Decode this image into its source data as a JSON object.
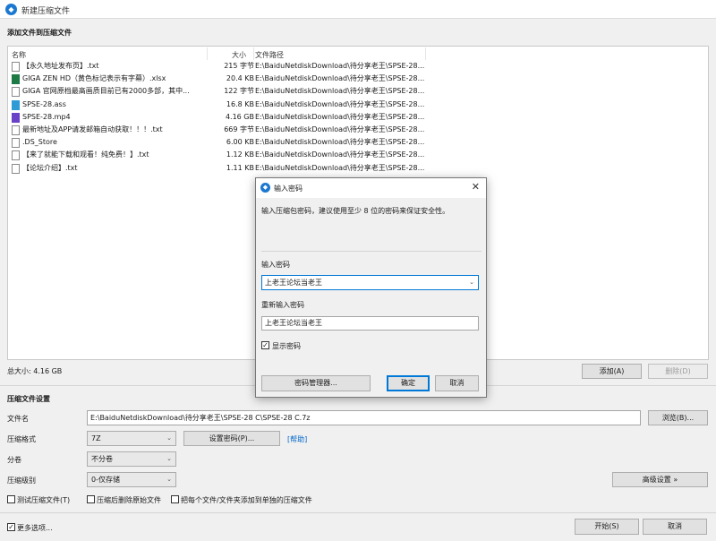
{
  "window": {
    "title": "新建压缩文件",
    "app_icon": "app-logo-icon"
  },
  "file_section": {
    "title": "添加文件到压缩文件",
    "columns": {
      "name": "名称",
      "size": "大小",
      "path": "文件路径"
    },
    "files": [
      {
        "name": "【永久地址发布页】.txt",
        "size": "215 字节",
        "path": "E:\\BaiduNetdiskDownload\\待分享老王\\SPSE-28...",
        "icon": "txt"
      },
      {
        "name": "GIGA ZEN HD（黄色标记表示有字幕）.xlsx",
        "size": "20.4 KB",
        "path": "E:\\BaiduNetdiskDownload\\待分享老王\\SPSE-28...",
        "icon": "xlsx"
      },
      {
        "name": "GIGA 官网原档最高画质目前已有2000多部，其中...",
        "size": "122 字节",
        "path": "E:\\BaiduNetdiskDownload\\待分享老王\\SPSE-28...",
        "icon": "txt"
      },
      {
        "name": "SPSE-28.ass",
        "size": "16.8 KB",
        "path": "E:\\BaiduNetdiskDownload\\待分享老王\\SPSE-28...",
        "icon": "ass"
      },
      {
        "name": "SPSE-28.mp4",
        "size": "4.16 GB",
        "path": "E:\\BaiduNetdiskDownload\\待分享老王\\SPSE-28...",
        "icon": "mp4"
      },
      {
        "name": "最新地址及APP请发邮箱自动获取！！！.txt",
        "size": "669 字节",
        "path": "E:\\BaiduNetdiskDownload\\待分享老王\\SPSE-28...",
        "icon": "txt"
      },
      {
        "name": ".DS_Store",
        "size": "6.00 KB",
        "path": "E:\\BaiduNetdiskDownload\\待分享老王\\SPSE-28...",
        "icon": "file"
      },
      {
        "name": "【来了就能下载和观看！纯免费！】.txt",
        "size": "1.12 KB",
        "path": "E:\\BaiduNetdiskDownload\\待分享老王\\SPSE-28...",
        "icon": "txt"
      },
      {
        "name": "【论坛介绍】.txt",
        "size": "1.11 KB",
        "path": "E:\\BaiduNetdiskDownload\\待分享老王\\SPSE-28...",
        "icon": "txt"
      }
    ],
    "total": "总大小: 4.16 GB",
    "add_label": "添加(A)",
    "delete_label": "删除(D)"
  },
  "settings": {
    "title": "压缩文件设置",
    "filename_label": "文件名",
    "filename_value": "E:\\BaiduNetdiskDownload\\待分享老王\\SPSE-28 C\\SPSE-28 C.7z",
    "browse_label": "浏览(B)...",
    "format_label": "压缩格式",
    "format_value": "7Z",
    "set_password_label": "设置密码(P)...",
    "help_label": "[帮助]",
    "split_label": "分卷",
    "split_value": "不分卷",
    "level_label": "压缩级别",
    "level_value": "0-仅存储",
    "advanced_label": "高级设置 »",
    "test_label": "测试压缩文件(T)",
    "delete_after_label": "压缩后删除原始文件",
    "separate_label": "把每个文件/文件夹添加到单独的压缩文件"
  },
  "footer": {
    "more_options_label": "更多选项...",
    "start_label": "开始(S)",
    "cancel_label": "取消"
  },
  "dialog": {
    "title": "输入密码",
    "hint": "输入压缩包密码，建议使用至少 8 位的密码来保证安全性。",
    "password_label": "输入密码",
    "password_value": "上老王论坛当老王",
    "confirm_label": "重新输入密码",
    "confirm_value": "上老王论坛当老王",
    "show_password_label": "显示密码",
    "manager_label": "密码管理器...",
    "ok_label": "确定",
    "cancel_label": "取消"
  }
}
